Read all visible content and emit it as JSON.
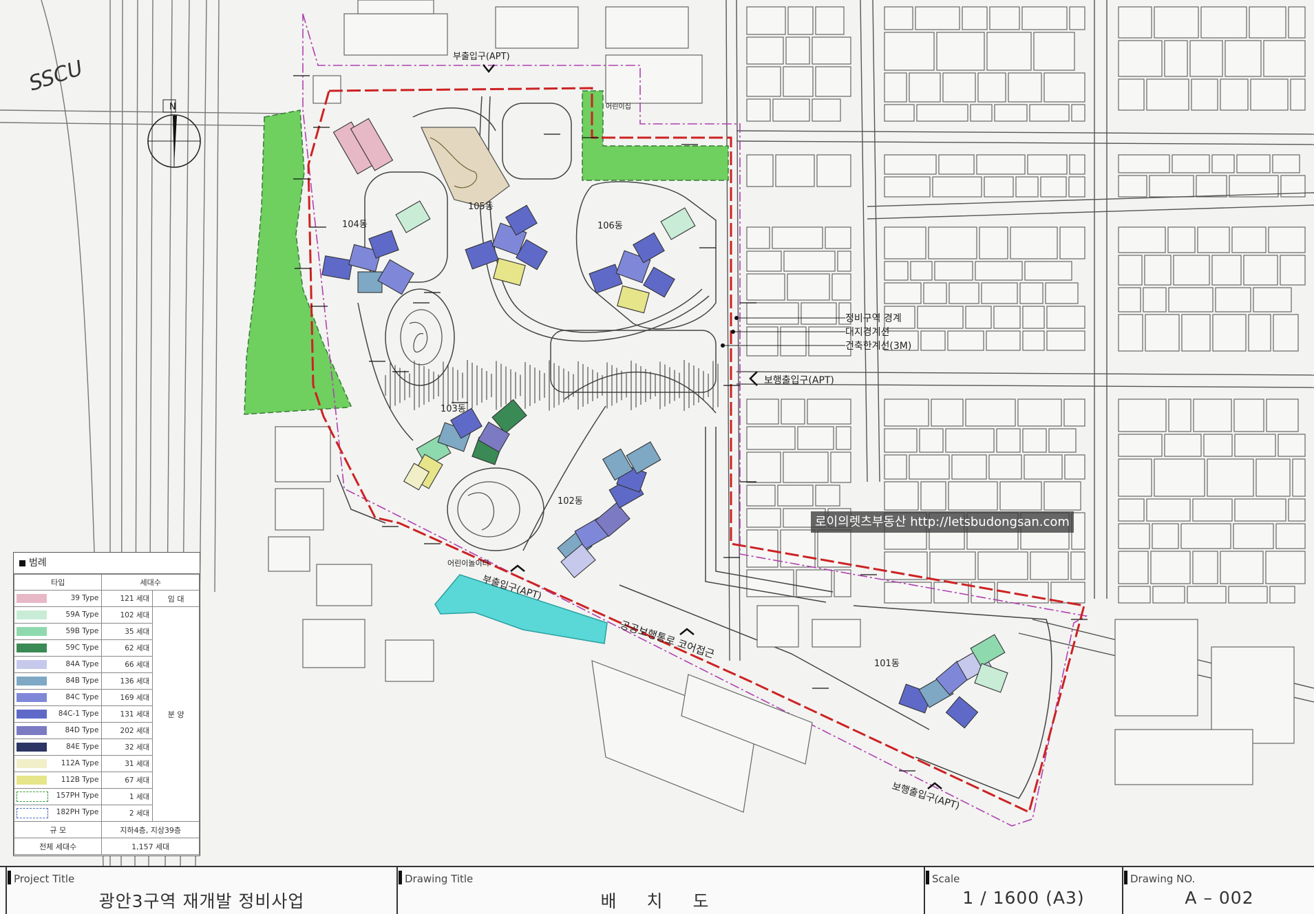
{
  "logo_text": "SSCU",
  "colors": {
    "green_area": "#6fcf5f",
    "cyan_area": "#5ad8d8",
    "boundary_red": "#cc2222",
    "boundary_purple": "#b040b0"
  },
  "compass": {
    "north": "N"
  },
  "map_labels": {
    "entrance_top": "부출입구(APT)",
    "pedestrian_entrance_right": "보행출입구(APT)",
    "sub_entrance_bottom": "부출입구(APT)",
    "public_path": "공공보행통로 코어접근",
    "pedestrian_entrance_bottom": "보행출입구(APT)",
    "bldg_104": "104동",
    "bldg_105": "105동",
    "bldg_106": "106동",
    "bldg_103": "103동",
    "bldg_102": "102동",
    "bldg_101": "101동",
    "kids_center": "어린이집",
    "bottom_area": "어린이놀이터"
  },
  "boundary_legend": [
    {
      "label": "정비구역 경계"
    },
    {
      "label": "대지경계선"
    },
    {
      "label": "건축한계선(3M)"
    }
  ],
  "legend": {
    "title": "범례",
    "headers": {
      "type": "타입",
      "count": "세대수"
    },
    "rows": [
      {
        "type": "39 Type",
        "count": "121 세대",
        "color": "#e7b8c6"
      },
      {
        "type": "59A Type",
        "count": "102 세대",
        "color": "#c9ecd6"
      },
      {
        "type": "59B Type",
        "count": "35 세대",
        "color": "#8fd9ae"
      },
      {
        "type": "59C Type",
        "count": "62 세대",
        "color": "#3a8a55"
      },
      {
        "type": "84A Type",
        "count": "66 세대",
        "color": "#c6c9ec"
      },
      {
        "type": "84B Type",
        "count": "136 세대",
        "color": "#7ea8c4"
      },
      {
        "type": "84C Type",
        "count": "169 세대",
        "color": "#7f88d8"
      },
      {
        "type": "84C-1 Type",
        "count": "131 세대",
        "color": "#5f6ac8"
      },
      {
        "type": "84D Type",
        "count": "202 세대",
        "color": "#7d7ac4"
      },
      {
        "type": "84E Type",
        "count": "32 세대",
        "color": "#2c3563"
      },
      {
        "type": "112A Type",
        "count": "31 세대",
        "color": "#f0efc8"
      },
      {
        "type": "112B Type",
        "count": "67 세대",
        "color": "#e6e58a"
      },
      {
        "type": "157PH Type",
        "count": "1 세대",
        "color": "#ffffff"
      },
      {
        "type": "182PH Type",
        "count": "2 세대",
        "color": "#ffffff"
      }
    ],
    "kind_rental": "임 대",
    "kind_sale": "분 양",
    "scale_label": "규 모",
    "scale_value": "지하4층, 지상39층",
    "total_label": "전체 세대수",
    "total_value": "1,157 세대"
  },
  "watermark": "로이의렛츠부동산 http://letsbudongsan.com",
  "title_block": {
    "project_label": "Project Title",
    "project_value": "광안3구역 재개발 정비사업",
    "drawing_label": "Drawing Title",
    "drawing_value": "배 치 도",
    "scale_label": "Scale",
    "scale_value": "1 / 1600 (A3)",
    "number_label": "Drawing NO.",
    "number_value": "A – 002"
  }
}
